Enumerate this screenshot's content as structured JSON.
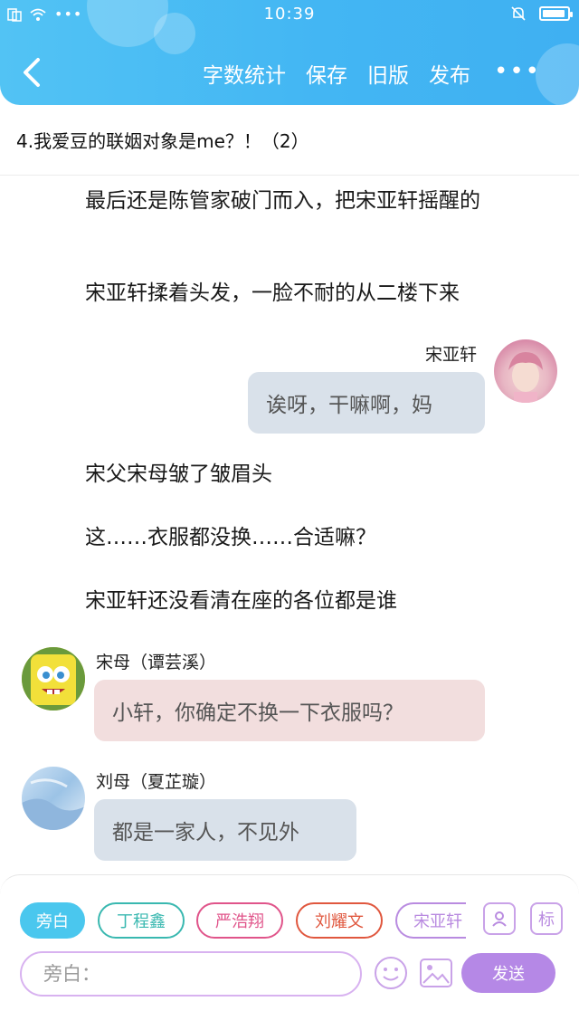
{
  "status_bar": {
    "time": "10:39"
  },
  "header": {
    "actions": [
      {
        "label": "字数统计"
      },
      {
        "label": "保存"
      },
      {
        "label": "旧版"
      },
      {
        "label": "发布"
      }
    ],
    "more": "•••"
  },
  "title": "4.我爱豆的联姻对象是me？！（2）",
  "story": {
    "narration_1": "最后还是陈管家破门而入，把宋亚轩摇醒的",
    "narration_2": "宋亚轩揉着头发，一脸不耐的从二楼下来",
    "chat_1": {
      "speaker": "宋亚轩",
      "text": "诶呀，干嘛啊，妈",
      "avatar": "pink-hair-avatar"
    },
    "narration_3": "宋父宋母皱了皱眉头",
    "narration_4": "这……衣服都没换……合适嘛？",
    "narration_5": "宋亚轩还没看清在座的各位都是谁",
    "chat_2": {
      "speaker": "宋母（谭芸溪）",
      "text": "小轩，你确定不换一下衣服吗？",
      "avatar": "spongebob-avatar"
    },
    "chat_3": {
      "speaker": "刘母（夏芷璇）",
      "text": "都是一家人，不见外",
      "avatar": "blue-sky-avatar"
    }
  },
  "composer": {
    "characters": [
      {
        "label": "旁白",
        "color": "#4ac7ee",
        "active": true
      },
      {
        "label": "丁程鑫",
        "color": "#39b8b0",
        "active": false
      },
      {
        "label": "严浩翔",
        "color": "#e0548a",
        "active": false
      },
      {
        "label": "刘耀文",
        "color": "#e0573e",
        "active": false
      },
      {
        "label": "宋亚轩",
        "color": "#b98be0",
        "active": false
      }
    ],
    "role_icon": "person-card-icon",
    "tag_label": "标",
    "input_placeholder": "旁白：",
    "emoji_icon": "smiley-icon",
    "image_icon": "picture-icon",
    "send_label": "发送"
  }
}
